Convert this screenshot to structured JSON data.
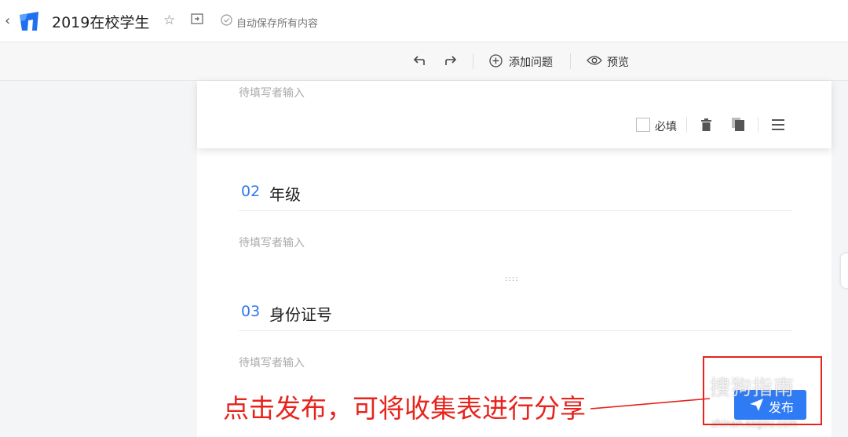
{
  "header": {
    "back_icon": "chevron-left-icon",
    "logo": "app-logo",
    "title": "2019在校学生",
    "star_icon": "star-icon",
    "folder_icon": "move-folder-icon",
    "save_icon": "check-circle-icon",
    "autosave_text": "自动保存所有内容"
  },
  "toolbar": {
    "undo_icon": "undo-icon",
    "redo_icon": "redo-icon",
    "add_question_label": "添加问题",
    "preview_label": "预览"
  },
  "questions": [
    {
      "placeholder": "待填写者输入",
      "required_label": "必填"
    },
    {
      "number": "02",
      "title": "年级",
      "placeholder": "待填写者输入"
    },
    {
      "number": "03",
      "title": "身份证号",
      "placeholder": "待填写者输入"
    }
  ],
  "drag_handle": "::::",
  "annotation": {
    "text": "点击发布，可将收集表进行分享",
    "color": "#e8231c"
  },
  "publish_button": {
    "label": "发布",
    "color": "#2f7bf5"
  },
  "watermark": {
    "text": "搜狗指南",
    "url": "zhinan.sogou.com"
  },
  "colors": {
    "accent": "#3377ee",
    "annotation": "#e8231c"
  }
}
